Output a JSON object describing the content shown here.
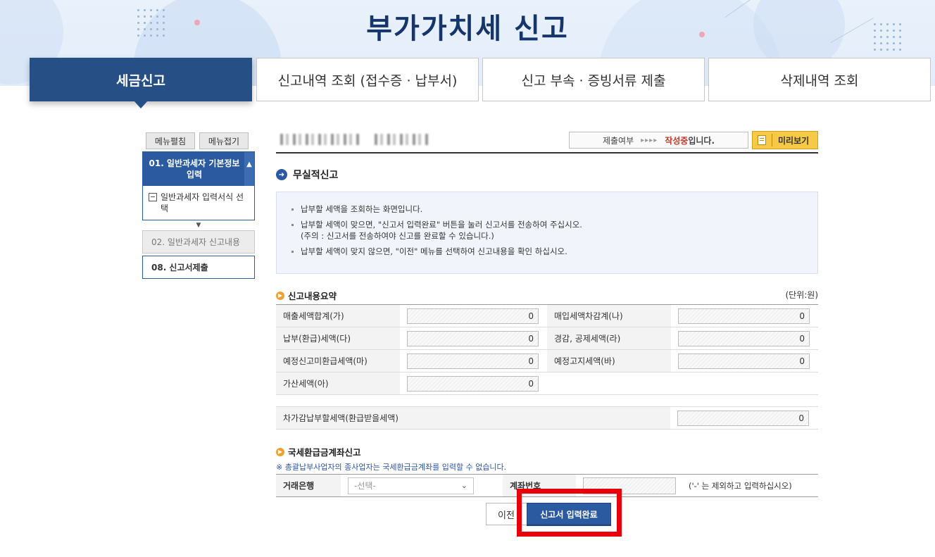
{
  "header": {
    "title": "부가가치세 신고"
  },
  "tabs": [
    {
      "label": "세금신고",
      "active": true
    },
    {
      "label": "신고내역 조회 (접수증 · 납부서)",
      "active": false
    },
    {
      "label": "신고 부속 · 증빙서류 제출",
      "active": false
    },
    {
      "label": "삭제내역 조회",
      "active": false
    }
  ],
  "sidebar": {
    "expand_label": "메뉴펼침",
    "collapse_label": "메뉴접기",
    "step1_label": "01. 일반과세자 기본정보 입력",
    "step1_sub_label": "일반과세자 입력서식 선택",
    "step2_label": "02. 일반과세자 신고내용",
    "step3_label": "08. 신고서제출"
  },
  "status": {
    "label": "제출여부",
    "arrows": "▸▸▸▸",
    "state": "작성중",
    "suffix": "입니다.",
    "preview_label": "미리보기"
  },
  "section": {
    "title": "무실적신고"
  },
  "notice": [
    "납부할 세액을 조회하는 화면입니다.",
    "납부할 세액이 맞으면, \"신고서 입력완료\" 버튼을 눌러 신고서를 전송하여 주십시오.",
    "(주의 : 신고서를 전송하여야 신고를 완료할 수 있습니다.)",
    "납부할 세액이 맞지 않으면, \"이전\" 메뉴를 선택하여 신고내용을 확인 하십시오."
  ],
  "summary": {
    "title": "신고내용요약",
    "unit": "(단위:원)",
    "rows": [
      {
        "l1": "매출세액합계(가)",
        "v1": "0",
        "l2": "매입세액차감계(나)",
        "v2": "0"
      },
      {
        "l1": "납부(환급)세액(다)",
        "v1": "0",
        "l2": "경감, 공제세액(라)",
        "v2": "0"
      },
      {
        "l1": "예정신고미환급세액(마)",
        "v1": "0",
        "l2": "예정고지세액(바)",
        "v2": "0"
      },
      {
        "l1": "가산세액(아)",
        "v1": "0"
      }
    ],
    "total_label": "차가감납부할세액(환급받을세액)",
    "total_value": "0"
  },
  "account": {
    "title": "국세환급금계좌신고",
    "note": "※ 총괄납부사업자의 종사업자는 국세환급금계좌를 입력할 수 없습니다.",
    "bank_label": "거래은행",
    "bank_placeholder": "-선택-",
    "account_label": "계좌번호",
    "hint": "('-' 는 제외하고 입력하십시오)"
  },
  "buttons": {
    "prev_label": "이전",
    "submit_label": "신고서 입력완료"
  },
  "colors": {
    "primary": "#264f86",
    "accent_red": "#e8000b",
    "status_red": "#c0392b",
    "preview_yellow": "#f7c948"
  }
}
